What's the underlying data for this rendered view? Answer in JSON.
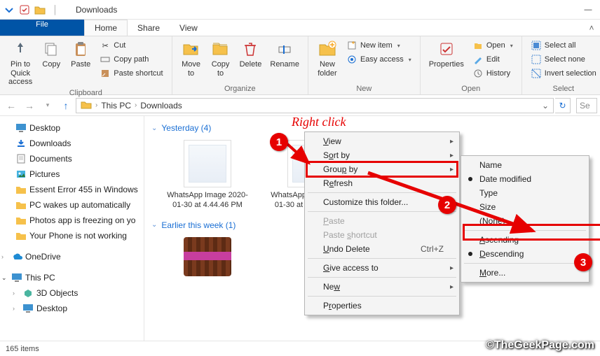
{
  "window": {
    "title": "Downloads"
  },
  "qat": {
    "items": [
      "arrow-down",
      "check",
      "folder",
      "divider"
    ]
  },
  "tabs": {
    "file": "File",
    "home": "Home",
    "share": "Share",
    "view": "View"
  },
  "ribbon": {
    "clipboard": {
      "label": "Clipboard",
      "pin": "Pin to Quick\naccess",
      "copy": "Copy",
      "paste": "Paste",
      "cut": "Cut",
      "copy_path": "Copy path",
      "paste_shortcut": "Paste shortcut"
    },
    "organize": {
      "label": "Organize",
      "move_to": "Move\nto",
      "copy_to": "Copy\nto",
      "delete": "Delete",
      "rename": "Rename"
    },
    "new": {
      "label": "New",
      "new_folder": "New\nfolder",
      "new_item": "New item",
      "easy_access": "Easy access"
    },
    "open": {
      "label": "Open",
      "properties": "Properties",
      "open": "Open",
      "edit": "Edit",
      "history": "History"
    },
    "select": {
      "label": "Select",
      "select_all": "Select all",
      "select_none": "Select none",
      "invert": "Invert selection"
    }
  },
  "addr": {
    "crumbs": [
      "This PC",
      "Downloads"
    ],
    "search_placeholder": "Se"
  },
  "nav": {
    "items": [
      {
        "label": "Desktop",
        "icon": "desktop",
        "indent": 1
      },
      {
        "label": "Downloads",
        "icon": "download",
        "indent": 1
      },
      {
        "label": "Documents",
        "icon": "document",
        "indent": 1
      },
      {
        "label": "Pictures",
        "icon": "picture",
        "indent": 1
      },
      {
        "label": "Essent Error 455 in Windows",
        "icon": "folder",
        "indent": 1
      },
      {
        "label": "PC wakes up automatically",
        "icon": "folder",
        "indent": 1
      },
      {
        "label": "Photos app is freezing on yo",
        "icon": "folder",
        "indent": 1
      },
      {
        "label": "Your Phone is not working",
        "icon": "folder",
        "indent": 1
      }
    ],
    "onedrive": "OneDrive",
    "thispc": "This PC",
    "thispc_items": [
      {
        "label": "3D Objects",
        "icon": "3d"
      },
      {
        "label": "Desktop",
        "icon": "desktop"
      }
    ]
  },
  "groups": {
    "g1": {
      "label": "Yesterday (4)",
      "files": [
        {
          "name": "WhatsApp Image 2020-01-30 at 4.44.46 PM",
          "type": "image"
        },
        {
          "name": "WhatsApp Image 2020-01-30 at 11.50.26 AM",
          "type": "image"
        }
      ]
    },
    "g2": {
      "label": "Earlier this week (1)",
      "files": [
        {
          "name": "",
          "type": "rar"
        }
      ]
    }
  },
  "ctx1": {
    "view": "View",
    "sort_by": "Sort by",
    "group_by": "Group by",
    "refresh": "Refresh",
    "customize": "Customize this folder...",
    "paste": "Paste",
    "paste_shortcut": "Paste shortcut",
    "undo_delete": "Undo Delete",
    "undo_accel": "Ctrl+Z",
    "give_access": "Give access to",
    "new": "New",
    "properties": "Properties"
  },
  "ctx2": {
    "name": "Name",
    "date_modified": "Date modified",
    "type": "Type",
    "size": "Size",
    "none": "(None)",
    "ascending": "Ascending",
    "descending": "Descending",
    "more": "More..."
  },
  "status": {
    "items": "165 items"
  },
  "anno": {
    "right_click": "Right click"
  },
  "watermark": "©TheGeekPage.com"
}
